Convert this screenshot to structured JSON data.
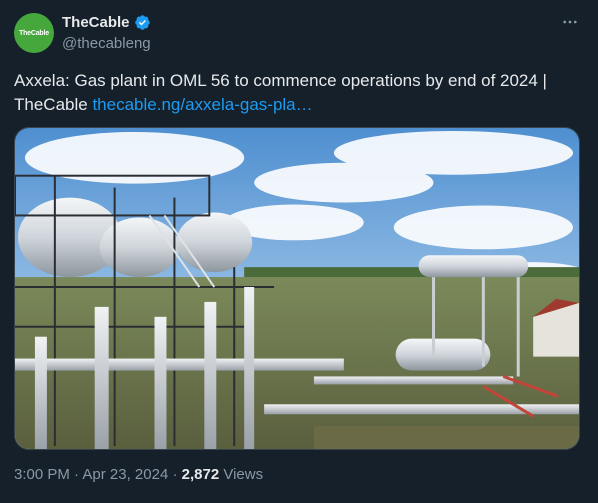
{
  "author": {
    "avatar_text": "TheCable",
    "display_name": "TheCable",
    "handle": "@thecableng",
    "verified_icon": "verified-badge-icon"
  },
  "tweet": {
    "text": "Axxela: Gas plant in OML 56 to commence operations by end of 2024 | TheCable",
    "link_text": "thecable.ng/axxela-gas-pla…",
    "image_alt": "Gas processing plant with storage tanks and pipelines"
  },
  "meta": {
    "time": "3:00 PM",
    "separator": "·",
    "date": "Apr 23, 2024",
    "views_count": "2,872",
    "views_label": "Views"
  },
  "colors": {
    "background": "#15202b",
    "text": "#e7e9ea",
    "muted": "#8b98a5",
    "link": "#1d9bf0",
    "avatar": "#46a83c"
  }
}
